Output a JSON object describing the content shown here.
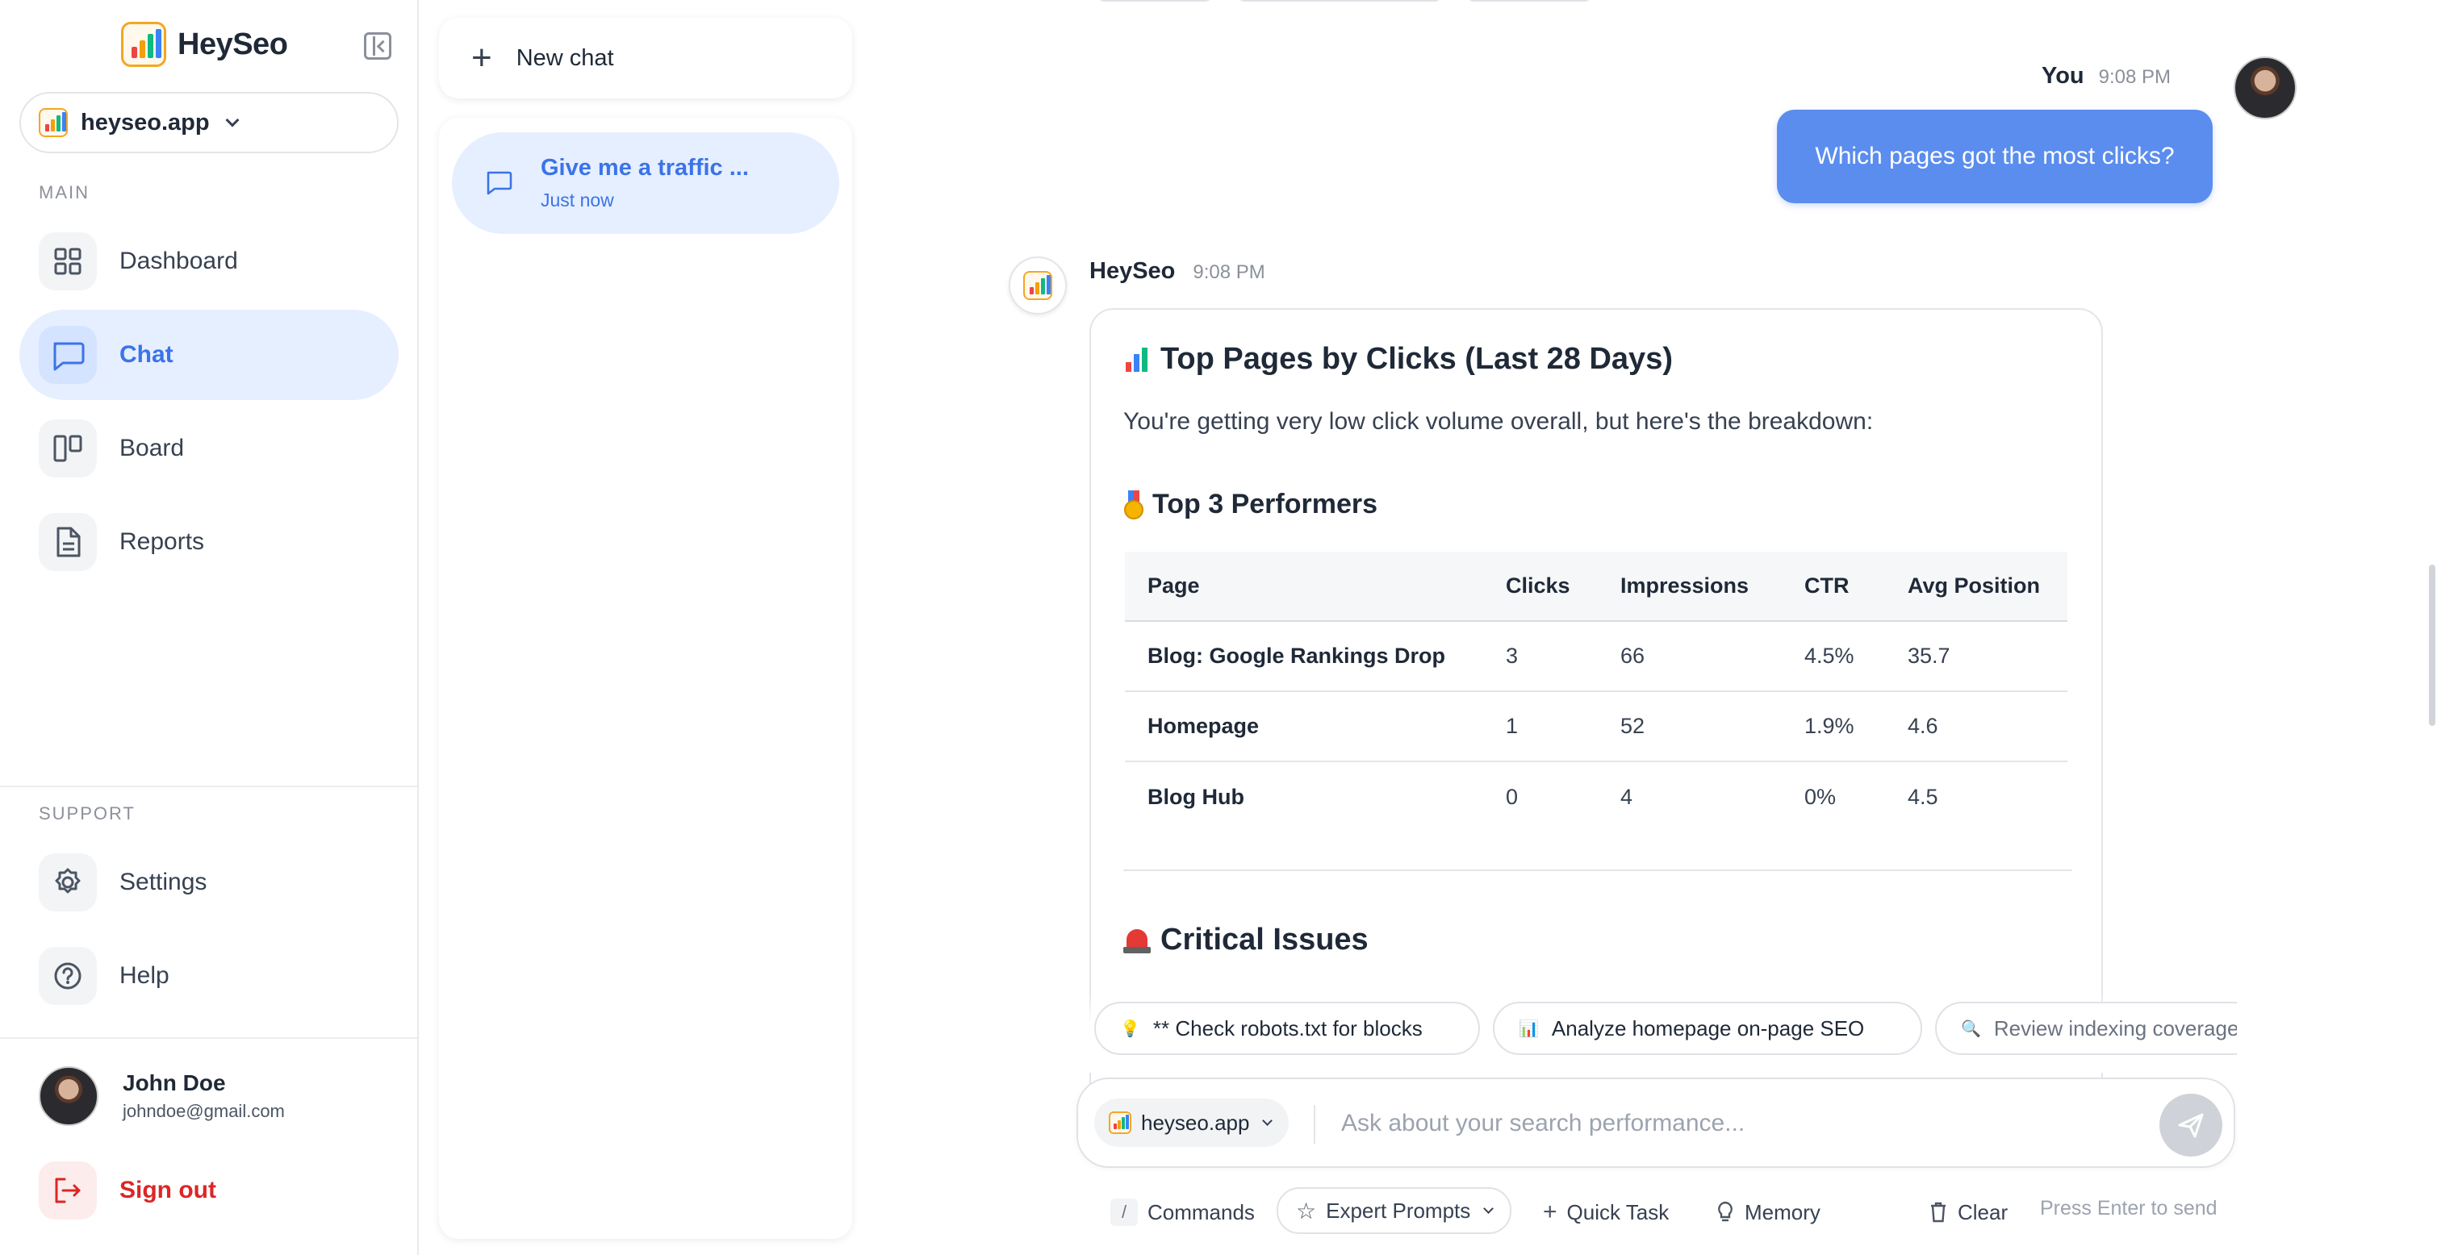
{
  "brand": {
    "name": "HeySeo"
  },
  "site_selector": {
    "site": "heyseo.app"
  },
  "sidebar": {
    "main_label": "MAIN",
    "items": [
      {
        "label": "Dashboard",
        "icon": "grid-icon"
      },
      {
        "label": "Chat",
        "icon": "chat-bubble-icon",
        "active": true
      },
      {
        "label": "Board",
        "icon": "board-columns-icon"
      },
      {
        "label": "Reports",
        "icon": "document-icon"
      }
    ],
    "support_label": "SUPPORT",
    "support_items": [
      {
        "label": "Settings",
        "icon": "gear-icon"
      },
      {
        "label": "Help",
        "icon": "help-circle-icon"
      }
    ],
    "user": {
      "name": "John Doe",
      "email": "johndoe@gmail.com"
    },
    "signout": {
      "label": "Sign out",
      "icon": "logout-icon"
    }
  },
  "chat_list": {
    "new_chat_label": "New chat",
    "items": [
      {
        "title": "Give me a traffic ...",
        "time": "Just now"
      }
    ]
  },
  "conversation": {
    "user_message": {
      "author": "You",
      "time": "9:08 PM",
      "text": "Which pages got the most clicks?"
    },
    "bot_message": {
      "author": "HeySeo",
      "time": "9:08 PM",
      "title": "Top Pages by Clicks (Last 28 Days)",
      "intro": "You're getting very low click volume overall, but here's the breakdown:",
      "subheading": "Top 3 Performers",
      "table": {
        "headers": [
          "Page",
          "Clicks",
          "Impressions",
          "CTR",
          "Avg Position"
        ],
        "rows": [
          [
            "Blog: Google Rankings Drop",
            "3",
            "66",
            "4.5%",
            "35.7"
          ],
          [
            "Homepage",
            "1",
            "52",
            "1.9%",
            "4.6"
          ],
          [
            "Blog Hub",
            "0",
            "4",
            "0%",
            "4.5"
          ]
        ]
      },
      "critical_heading": "Critical Issues"
    }
  },
  "suggestions": [
    {
      "icon": "💡",
      "label": "** Check robots.txt for blocks"
    },
    {
      "icon": "📊",
      "label": "Analyze homepage on-page SEO"
    },
    {
      "icon": "🔍",
      "label": "Review indexing coverage"
    }
  ],
  "composer": {
    "site": "heyseo.app",
    "placeholder": "Ask about your search performance...",
    "toolbar": {
      "commands": "Commands",
      "commands_key": "/",
      "expert_prompts": "Expert Prompts",
      "quick_task": "Quick Task",
      "memory": "Memory",
      "clear": "Clear",
      "enter_hint": "Press Enter to send"
    }
  },
  "colors": {
    "accent": "#3b73e8",
    "user_bubble": "#5b8def",
    "active_nav_bg": "#e6efff",
    "signout": "#dc2626"
  }
}
